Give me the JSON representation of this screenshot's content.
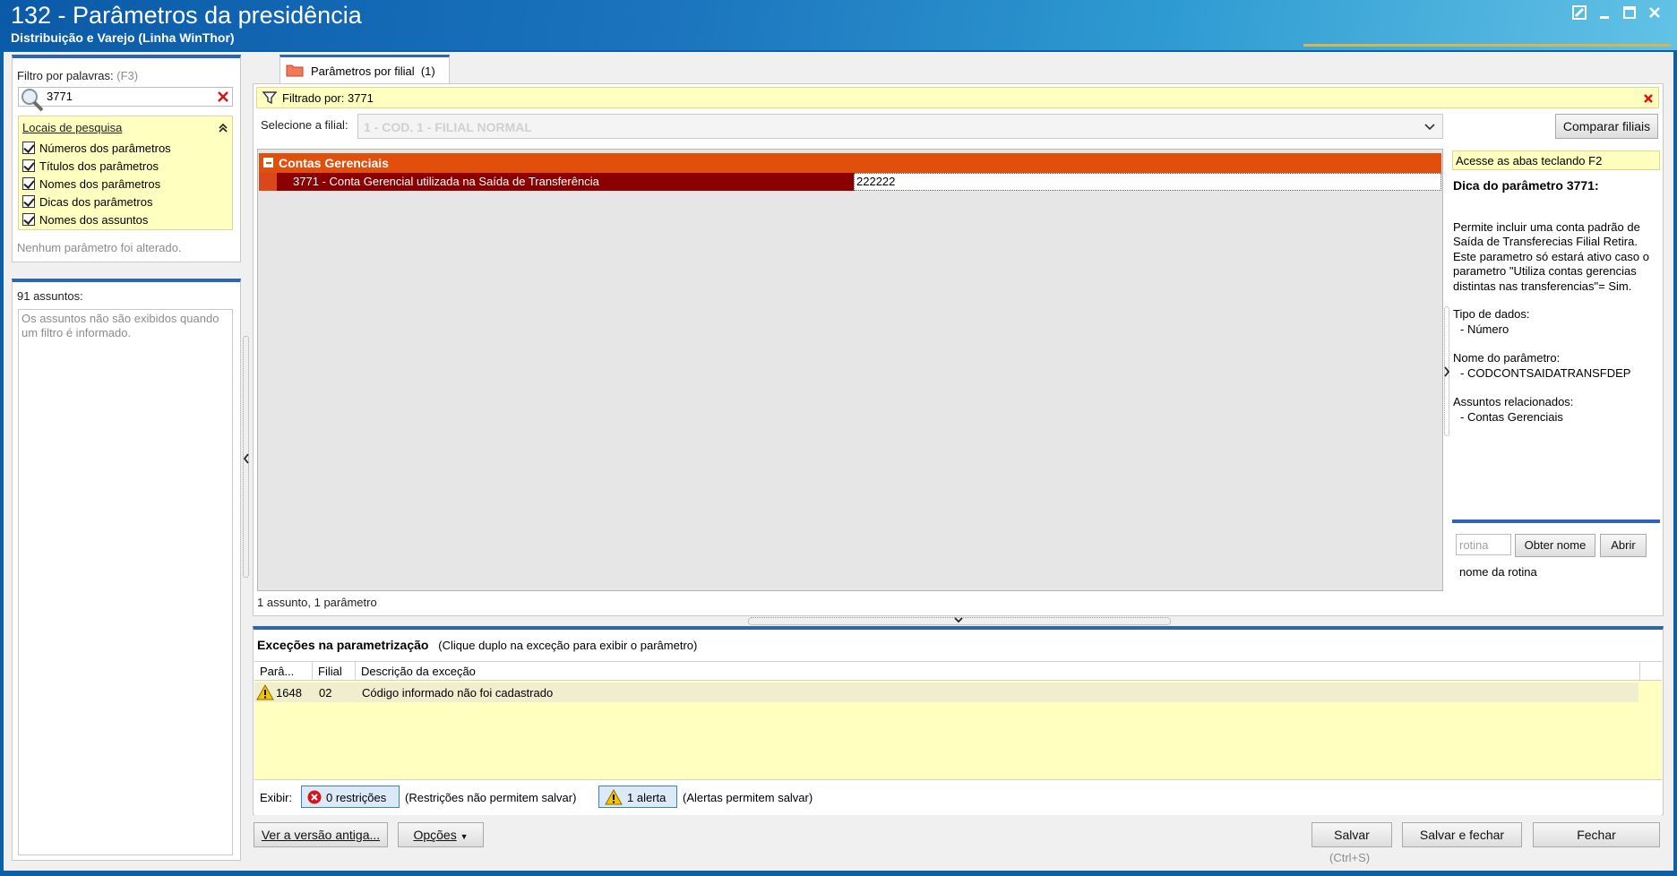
{
  "window": {
    "title": "132 - Parâmetros da presidência",
    "subtitle": "Distribuição e Varejo (Linha WinThor)",
    "controls": [
      "edit-icon",
      "minimize-icon",
      "maximize-icon",
      "close-icon"
    ]
  },
  "filter": {
    "label": "Filtro por palavras:",
    "shortcut": "(F3)",
    "value": "3771",
    "search_places_label": "Locais de pesquisa",
    "options": [
      {
        "label": "Números dos parâmetros",
        "checked": true
      },
      {
        "label": "Títulos dos parâmetros",
        "checked": true
      },
      {
        "label": "Nomes dos parâmetros",
        "checked": true
      },
      {
        "label": "Dicas dos parâmetros",
        "checked": true
      },
      {
        "label": "Nomes dos assuntos",
        "checked": true
      }
    ],
    "status": "Nenhum parâmetro foi alterado."
  },
  "subjects": {
    "label": "91 assuntos:",
    "message": "Os assuntos não são exibidos quando um filtro é informado."
  },
  "tab": {
    "label": "Parâmetros por filial",
    "count": "(1)"
  },
  "filtered": {
    "text": "Filtrado por: 3771"
  },
  "branch": {
    "label": "Selecione a filial:",
    "value": "1 - COD. 1 - FILIAL NORMAL",
    "compare_button": "Comparar filiais"
  },
  "parameters": {
    "group_title": "Contas Gerenciais",
    "row_label": "3771 - Conta Gerencial utilizada na Saída de Transferência",
    "row_value": "222222",
    "summary": "1 assunto, 1 parâmetro"
  },
  "tip": {
    "hint": "Acesse as abas teclando F2",
    "title": "Dica do parâmetro 3771:",
    "description": "Permite incluir uma conta padrão de Saída de Transferecias Filial Retira. Este parametro só estará ativo caso o parametro \"Utiliza contas gerencias distintas nas transferencias\"= Sim.",
    "data_type_label": "Tipo de dados:",
    "data_type_value": "- Número",
    "param_name_label": "Nome do parâmetro:",
    "param_name_value": "- CODCONTSAIDATRANSFDEP",
    "related_label": "Assuntos relacionados:",
    "related_value": "- Contas Gerenciais",
    "routine_placeholder": "rotina",
    "get_name_button": "Obter nome",
    "open_button": "Abrir",
    "routine_name": "nome da rotina"
  },
  "exceptions": {
    "title": "Exceções na parametrização",
    "hint": "(Clique duplo na exceção para exibir o parâmetro)",
    "columns": [
      "Parâ...",
      "Filial",
      "Descrição da exceção"
    ],
    "rows": [
      {
        "icon": "warning-icon",
        "param": "1648",
        "branch": "02",
        "description": "Código informado não foi cadastrado"
      }
    ],
    "show_label": "Exibir:",
    "restrictions_button": "0 restrições",
    "restrictions_note": "(Restrições não permitem salvar)",
    "alerts_button": "1 alerta",
    "alerts_note": "(Alertas permitem salvar)"
  },
  "footer": {
    "old_version_button": "Ver a versão antiga...",
    "options_button": "Opções",
    "save_button": "Salvar",
    "save_shortcut": "(Ctrl+S)",
    "save_close_button": "Salvar e fechar",
    "close_button": "Fechar"
  },
  "colors": {
    "title_blue": "#1b74bd",
    "group_orange": "#e24e0b",
    "row_red": "#8b0000",
    "highlight_yellow": "#ffffc0",
    "panel_blue": "#2b64b8"
  }
}
